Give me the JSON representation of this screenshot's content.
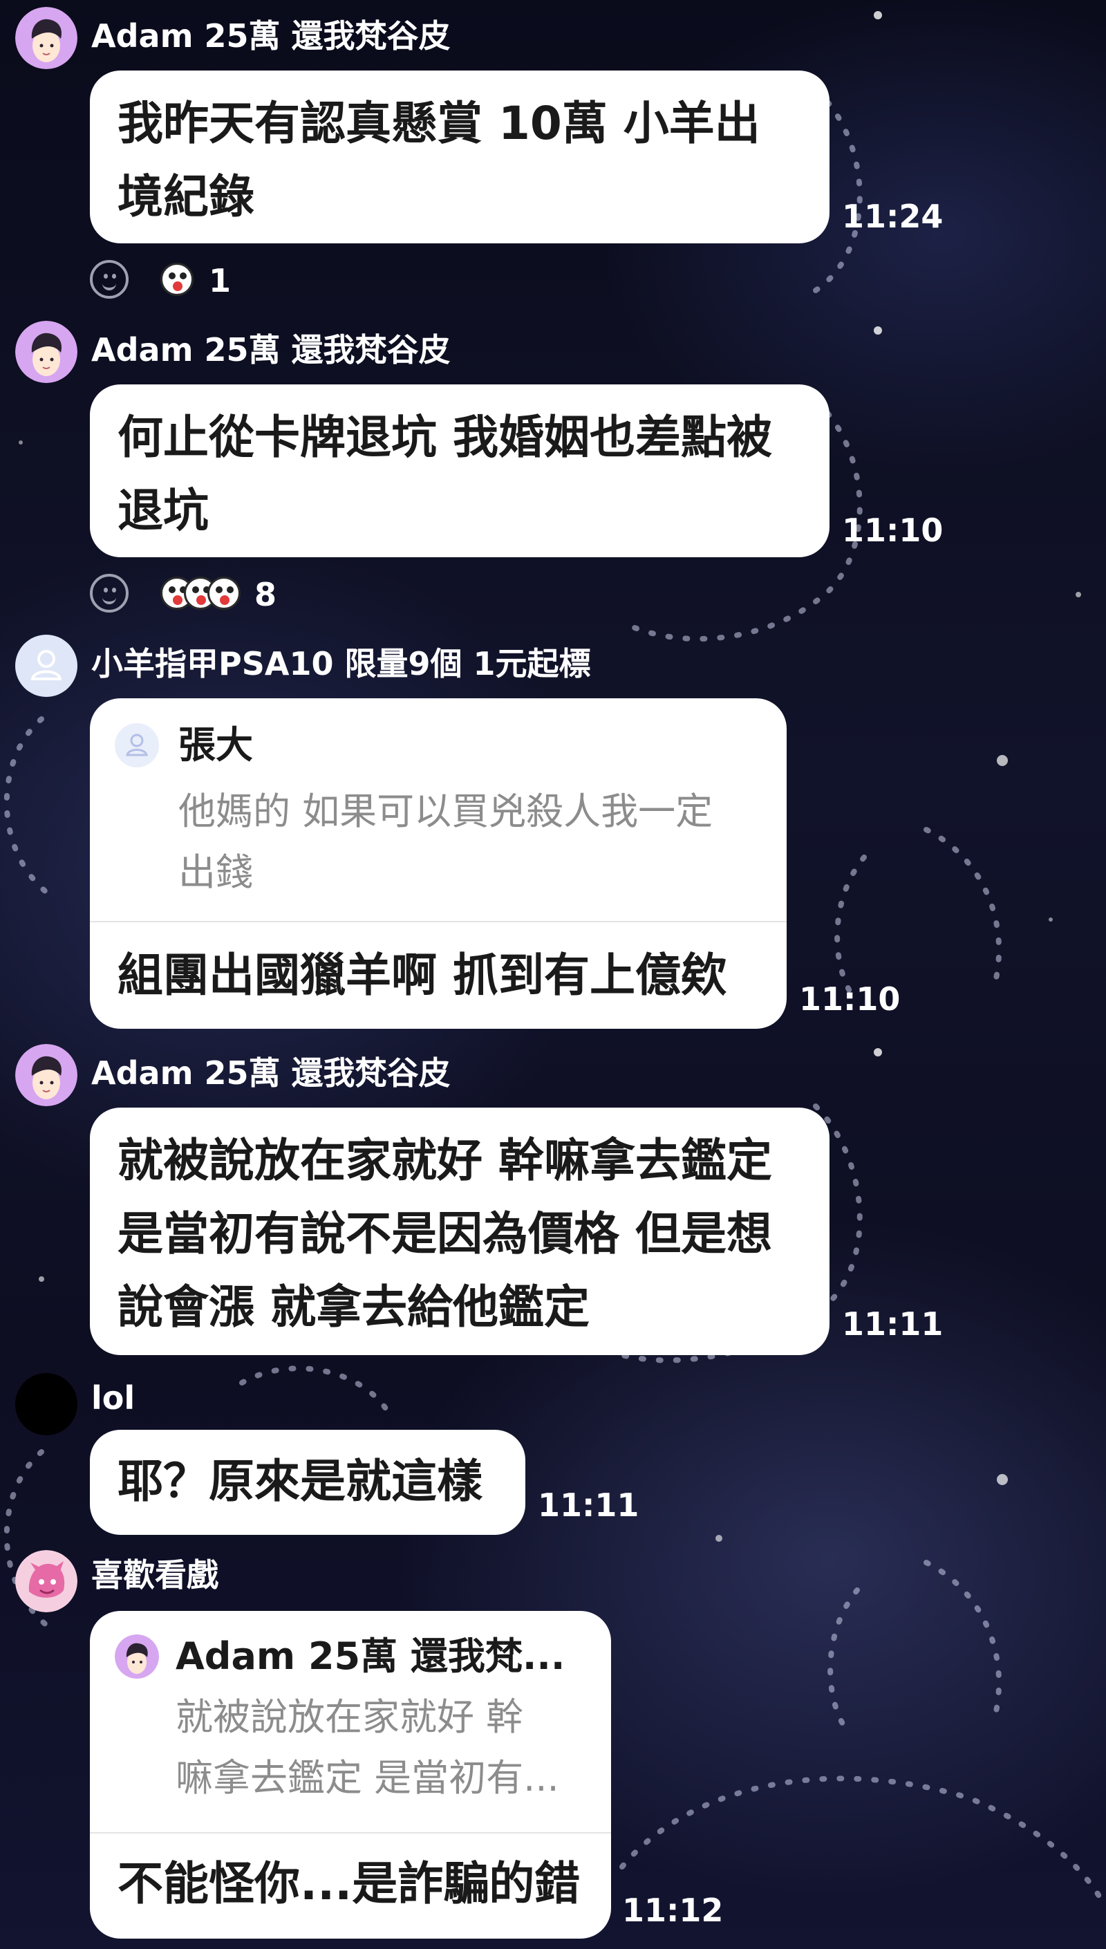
{
  "messages": [
    {
      "sender": "Adam 25萬 還我梵谷皮",
      "text": "我昨天有認真懸賞 10萬 小羊出\n境紀錄",
      "time": "11:24",
      "reaction_count": "1"
    },
    {
      "sender": "Adam 25萬 還我梵谷皮",
      "text": "何止從卡牌退坑 我婚姻也差點被\n退坑",
      "time": "11:10",
      "reaction_count": "8"
    },
    {
      "sender": "小羊指甲PSA10 限量9個 1元起標",
      "quote_name": "張大",
      "quote_text": "他媽的 如果可以買兇殺人我一定\n出錢",
      "text": "組團出國獵羊啊 抓到有上億欸",
      "time": "11:10"
    },
    {
      "sender": "Adam 25萬 還我梵谷皮",
      "text": "就被說放在家就好 幹嘛拿去鑑定\n是當初有說不是因為價格 但是想\n說會漲 就拿去給他鑑定",
      "time": "11:11"
    },
    {
      "sender": "lol",
      "text": "耶？原來是就這樣",
      "time": "11:11"
    },
    {
      "sender": "喜歡看戲",
      "quote_name": "Adam 25萬 還我梵...",
      "quote_text": "就被說放在家就好 幹\n嘛拿去鑑定 是當初有...",
      "text": "不能怪你...是詐騙的錯",
      "time": "11:12"
    }
  ],
  "colors": {
    "bubble": "#ffffff",
    "background": "#0b0c1d",
    "quote_text": "#8c8c8c"
  },
  "icons": {
    "avatar_adam": "cartoon-man-avatar-icon",
    "avatar_default": "default-user-icon",
    "avatar_lol": "black-circle-avatar",
    "avatar_drama": "pink-character-avatar",
    "add_reaction": "smiley-add-reaction-icon"
  }
}
